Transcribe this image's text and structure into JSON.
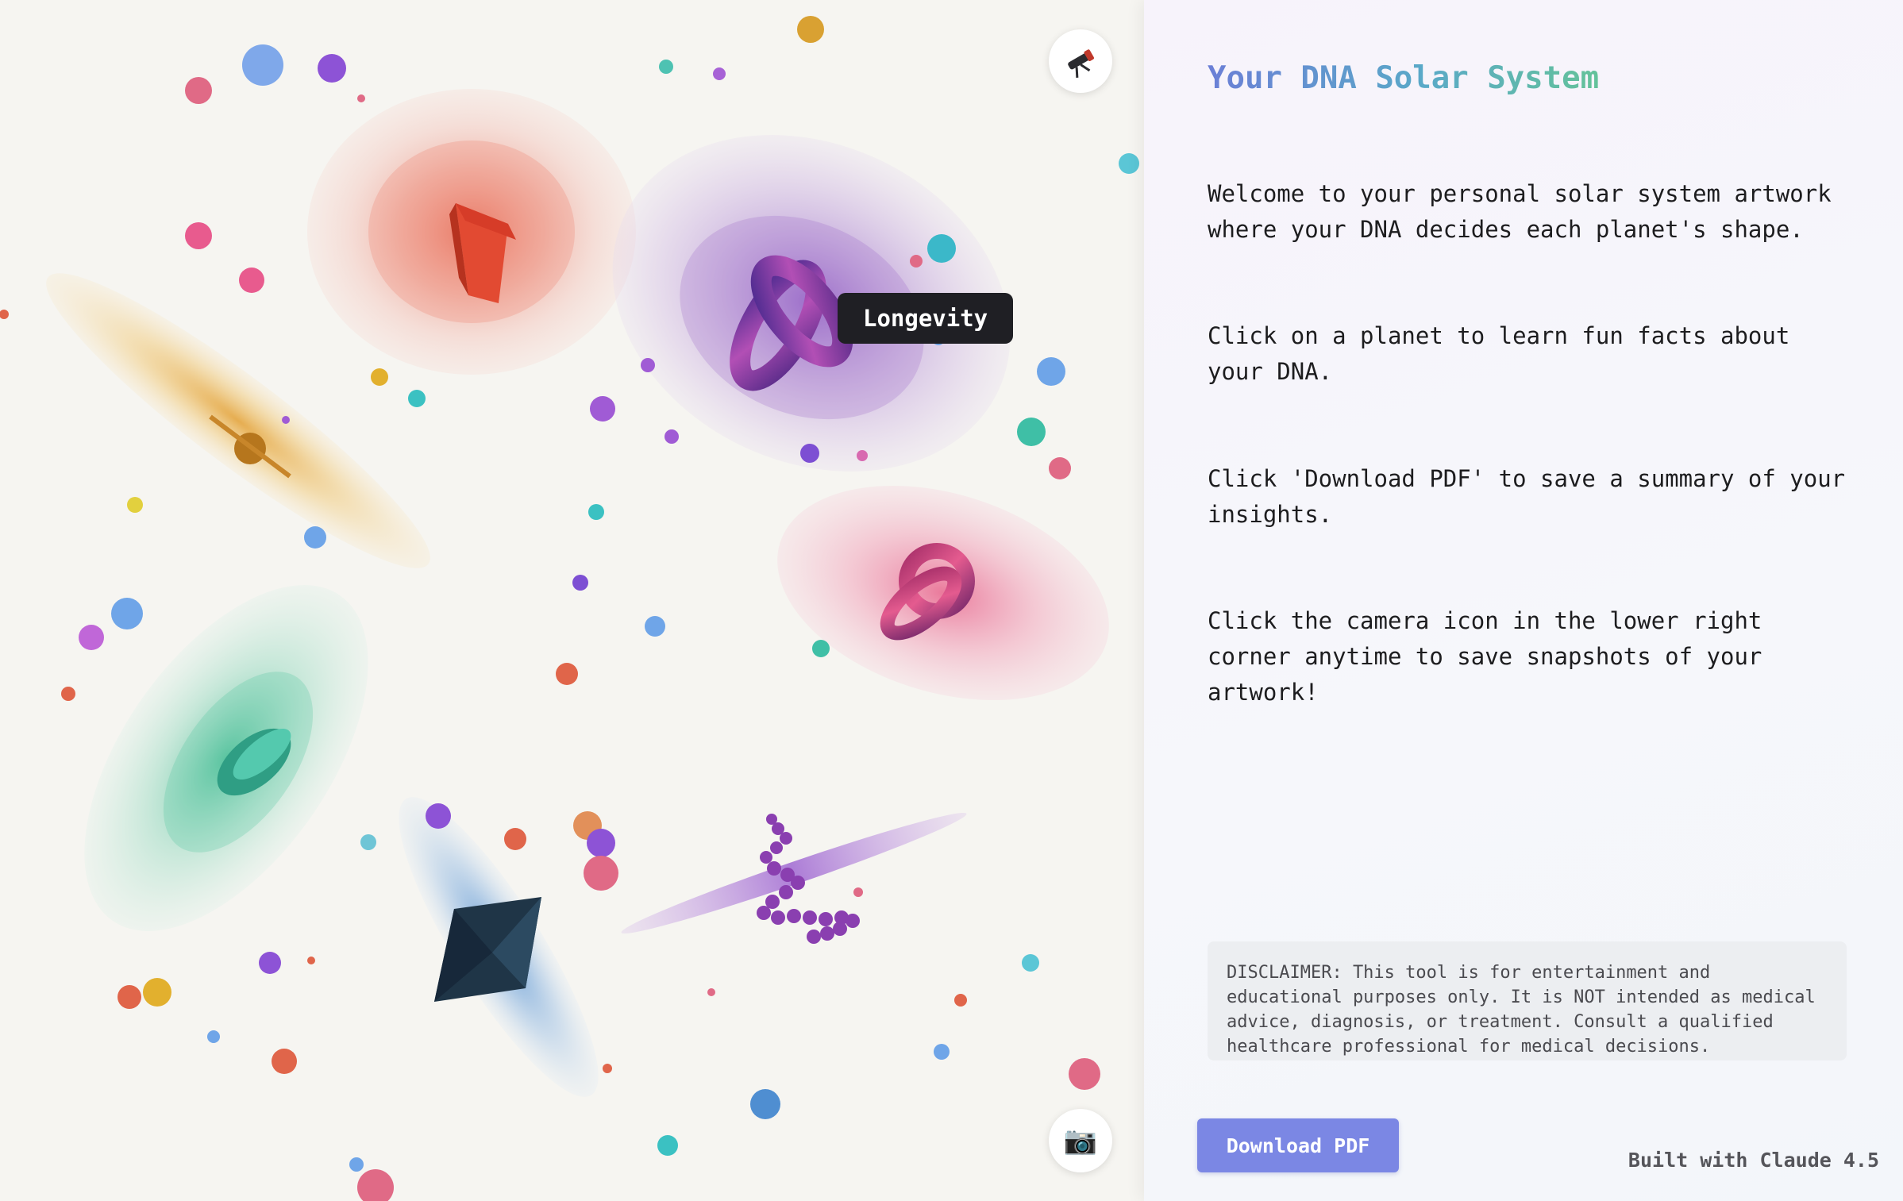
{
  "canvas": {
    "tooltip_text": "Longevity",
    "top_button_icon": "telescope-icon",
    "bottom_button_icon": "camera-icon",
    "camera_glyph": "📷"
  },
  "panel": {
    "title": "Your DNA Solar System",
    "paragraphs": [
      "Welcome to your personal solar system artwork where your DNA decides each planet's shape.",
      "Click on a planet to learn fun facts about your DNA.",
      "Click 'Download PDF' to save a summary of your insights.",
      "Click the camera icon in the lower right corner anytime to save snapshots of your artwork!"
    ],
    "disclaimer": "DISCLAIMER: This tool is for entertainment and educational purposes only. It is NOT intended as medical advice, diagnosis, or treatment. Consult a qualified healthcare professional for medical decisions.",
    "download_label": "Download PDF",
    "built_with": "Built with Claude 4.5"
  },
  "colors": {
    "title_gradient": [
      "#6b7fd6",
      "#5aa9c8",
      "#64c29a"
    ],
    "button": "#7b87e4",
    "tooltip_bg": "#1f1f24"
  }
}
